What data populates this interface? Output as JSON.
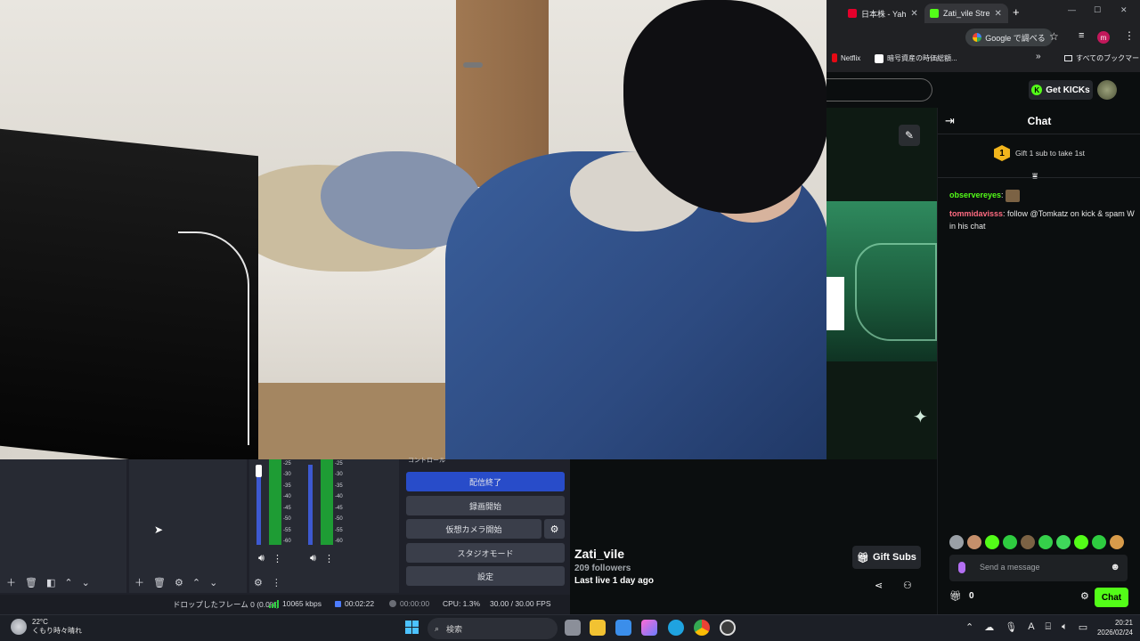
{
  "browser": {
    "tabs": [
      {
        "label": "日本株 - Yah",
        "active": false,
        "favicon_color": "#e4002b"
      },
      {
        "label": "Zati_vile Stre",
        "active": true,
        "favicon_color": "#53fc18"
      }
    ],
    "tab_close": "✕",
    "new_tab": "+",
    "window_controls": [
      "—",
      "☐",
      "✕"
    ],
    "google_button": "Google で調べる",
    "star_icon": "☆",
    "profile_letter": "m",
    "bookmarks": [
      "Netflix",
      "暗号資産の時価総額...",
      "»",
      "すべてのブックマーク"
    ]
  },
  "kick": {
    "get_kicks": "Get KICKs",
    "chat_title": "Chat",
    "gift_prompt": "Gift 1 sub to take 1st",
    "gift_badge": "1",
    "messages": [
      {
        "user": "observereyes",
        "color": "#53fc18",
        "text": ""
      },
      {
        "user": "tommidavisss",
        "color": "#ff6b81",
        "text": "follow @Tomkatz on kick & spam W in his chat"
      }
    ],
    "input_placeholder": "Send a message",
    "gift_count": "0",
    "chat_button": "Chat",
    "channel_name": "Zati_vile",
    "followers": "209 followers",
    "last_live": "Last live 1 day ago",
    "gift_subs": "Gift Subs",
    "accent": "#53fc18"
  },
  "obs": {
    "controls_label": "コントロール",
    "buttons": [
      "配信終了",
      "録画開始",
      "仮想カメラ開始",
      "スタジオモード",
      "設定"
    ],
    "db_labels": [
      "-25",
      "-30",
      "-35",
      "-40",
      "-45",
      "-50",
      "-55",
      "-60"
    ],
    "status": {
      "dropped": "ドロップしたフレーム 0 (0.0%)",
      "bitrate": "10065 kbps",
      "live_time": "00:02:22",
      "rec_time": "00:00:00",
      "cpu": "CPU: 1.3%",
      "fps": "30.00 / 30.00 FPS"
    }
  },
  "taskbar": {
    "temp": "22°C",
    "weather": "くもり時々晴れ",
    "search": "検索",
    "time": "20:21",
    "date": "2026/02/24"
  }
}
